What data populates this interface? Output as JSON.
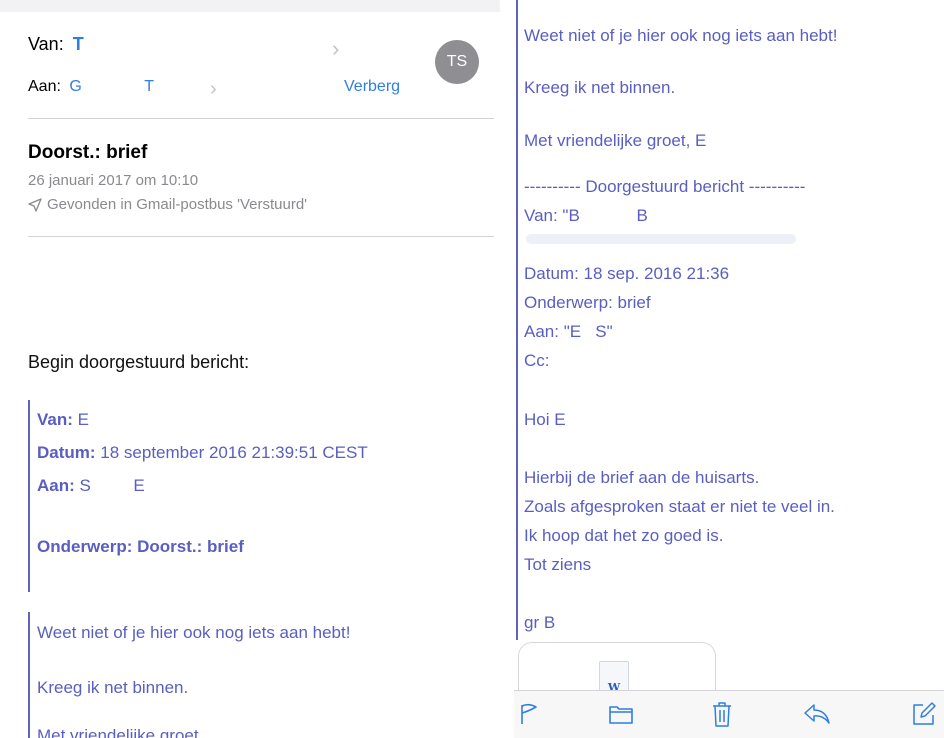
{
  "header": {
    "from_label": "Van:",
    "from_name": "T",
    "to_label": "Aan:",
    "to_name_1": "G",
    "to_name_2": "T",
    "hide_label": "Verberg",
    "avatar_initials": "TS"
  },
  "message": {
    "subject": "Doorst.: brief",
    "date": "26 januari 2017 om 10:10",
    "found_in": "Gevonden in Gmail-postbus 'Verstuurd'"
  },
  "forward": {
    "intro": "Begin doorgestuurd bericht:",
    "from_label": "Van:",
    "from_value": "E",
    "date_label": "Datum:",
    "date_value": "18 september 2016 21:39:51 CEST",
    "to_label": "Aan:",
    "to_value": "S         E",
    "subject_label": "Onderwerp:",
    "subject_value": "Doorst.: brief"
  },
  "left_body": {
    "line1": "Weet niet of je hier ook nog iets aan hebt!",
    "line2": "Kreeg ik net binnen.",
    "line3": "Met vriendelijke groet"
  },
  "right_body": {
    "line1": "Weet niet of je hier ook nog iets aan hebt!",
    "line2": "Kreeg ik net binnen.",
    "line3": "Met vriendelijke groet, E",
    "separator": "---------- Doorgestuurd bericht ----------",
    "van": "Van: \"B            B",
    "datum": "Datum: 18 sep. 2016 21:36",
    "onderwerp": "Onderwerp: brief",
    "aan": "Aan: \"E   S\"",
    "cc": "Cc:",
    "greeting": "Hoi E",
    "p1": "Hierbij de brief aan de huisarts.",
    "p2": "Zoals afgesproken staat er niet te veel in.",
    "p3": "Ik hoop dat het zo goed is.",
    "p4": "Tot ziens",
    "signoff": "gr B"
  },
  "attachment": {
    "icon": "word-document-icon",
    "glyph": "W"
  },
  "toolbar": {
    "icons": [
      "flag-icon",
      "folder-icon",
      "trash-icon",
      "reply-icon",
      "compose-icon"
    ],
    "accent": "#2f7fe0"
  },
  "colors": {
    "link_blue": "#2f7fe0",
    "quote_purple": "#5a5ec0",
    "quote_bar": "#6064b8",
    "meta_gray": "#8a8a8e"
  }
}
